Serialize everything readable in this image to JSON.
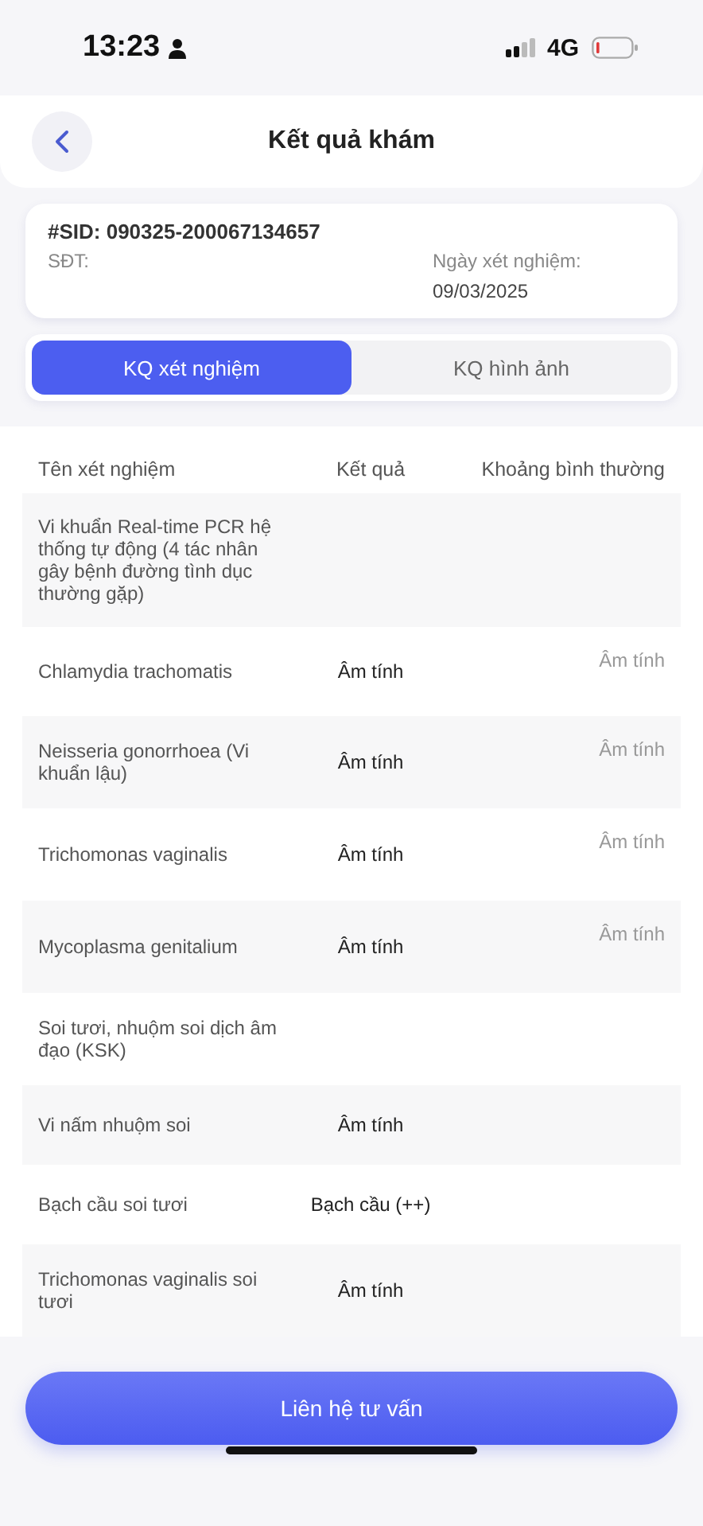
{
  "status_bar": {
    "time": "13:23",
    "network": "4G"
  },
  "header": {
    "title": "Kết quả khám"
  },
  "info": {
    "sid": "#SID: 090325-200067134657",
    "phone_label": "SĐT:",
    "date_label": "Ngày xét nghiệm:",
    "date": "09/03/2025"
  },
  "tabs": [
    {
      "label": "KQ xét nghiệm",
      "selected": true
    },
    {
      "label": "KQ hình ảnh",
      "selected": false
    }
  ],
  "table": {
    "columns": [
      "Tên xét nghiệm",
      "Kết quả",
      "Khoảng bình thường"
    ],
    "rows": [
      {
        "name": "Vi khuẩn Real-time PCR hệ thống tự động (4 tác nhân gây bệnh đường tình dục thường gặp)"
      },
      {
        "name": "Chlamydia trachomatis",
        "result": "Âm tính",
        "normal": "Âm tính"
      },
      {
        "name": "Neisseria gonorrhoea (Vi khuẩn lậu)",
        "result": "Âm tính",
        "normal": "Âm tính"
      },
      {
        "name": "Trichomonas vaginalis",
        "result": "Âm tính",
        "normal": "Âm tính"
      },
      {
        "name": "Mycoplasma genitalium",
        "result": "Âm tính",
        "normal": "Âm tính"
      },
      {
        "name": "Soi tươi, nhuộm soi dịch âm đạo (KSK)"
      },
      {
        "name": "Vi nấm nhuộm soi",
        "result": "Âm tính"
      },
      {
        "name": "Bạch cầu soi tươi",
        "result": "Bạch cầu (++)"
      },
      {
        "name": "Trichomonas vaginalis soi tươi",
        "result": "Âm tính"
      }
    ]
  },
  "contact_button": "Liên hệ tư vấn"
}
